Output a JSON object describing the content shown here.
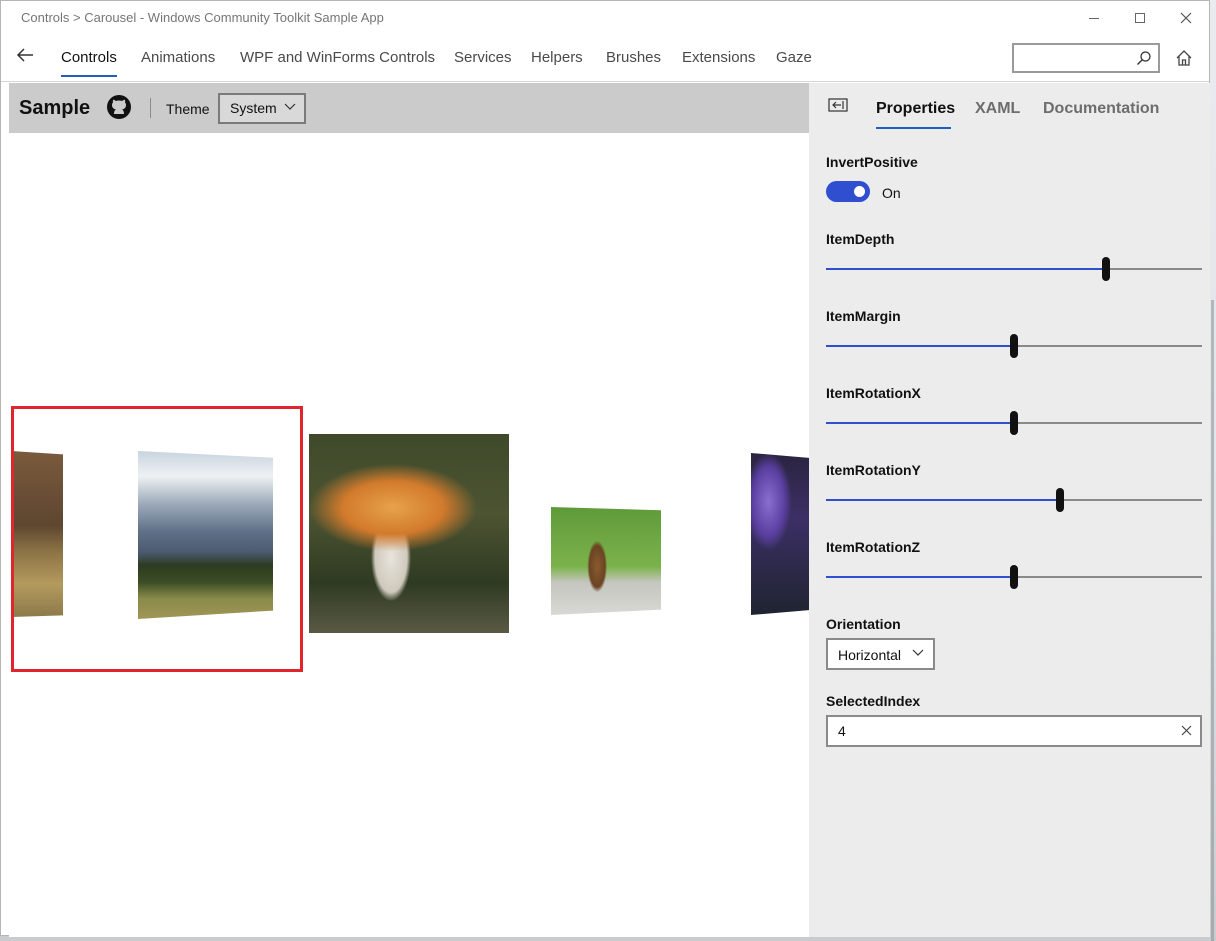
{
  "window": {
    "title": "Controls > Carousel - Windows Community Toolkit Sample App"
  },
  "nav": {
    "items": [
      "Controls",
      "Animations",
      "WPF and WinForms Controls",
      "Services",
      "Helpers",
      "Brushes",
      "Extensions",
      "Gaze"
    ],
    "active": "Controls",
    "search_placeholder": ""
  },
  "sample": {
    "title": "Sample",
    "theme_label": "Theme",
    "theme_value": "System"
  },
  "panel": {
    "tabs": [
      "Properties",
      "XAML",
      "Documentation"
    ],
    "active_tab": "Properties",
    "properties": {
      "invert_positive": {
        "label": "InvertPositive",
        "state": "On",
        "checked": true
      },
      "item_depth": {
        "label": "ItemDepth",
        "value_fraction": 0.745
      },
      "item_margin": {
        "label": "ItemMargin",
        "value_fraction": 0.5
      },
      "item_rotation_x": {
        "label": "ItemRotationX",
        "value_fraction": 0.5
      },
      "item_rotation_y": {
        "label": "ItemRotationY",
        "value_fraction": 0.622
      },
      "item_rotation_z": {
        "label": "ItemRotationZ",
        "value_fraction": 0.5
      },
      "orientation": {
        "label": "Orientation",
        "value": "Horizontal"
      },
      "selected_index": {
        "label": "SelectedIndex",
        "value": "4"
      }
    }
  },
  "carousel": {
    "items": [
      "rock-cliff-photo",
      "mountain-photo",
      "mushroom-photo",
      "chipmunk-photo",
      "purple-flowers-photo"
    ],
    "highlight_color": "#e0262c"
  },
  "colors": {
    "accent": "#2f4fd0",
    "nav_underline": "#1f5fbf",
    "sample_bar": "#cbcbcb",
    "panel_bg": "#ececec"
  }
}
